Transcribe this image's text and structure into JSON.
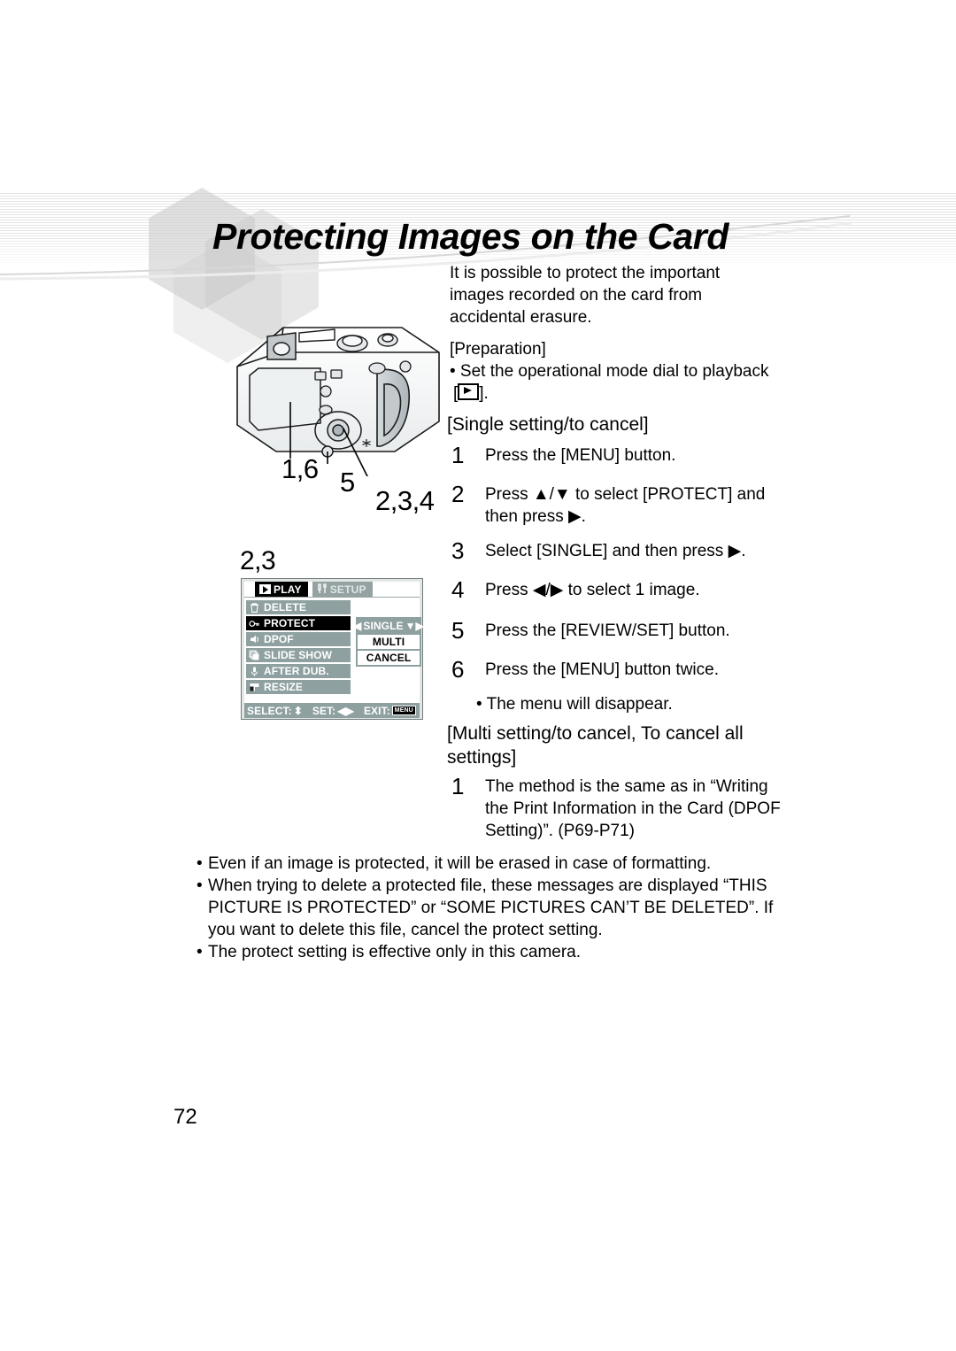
{
  "page": {
    "title": "Protecting Images on the Card",
    "number": "72"
  },
  "intro": {
    "text": "It is possible to protect the important images recorded on the card from accidental erasure."
  },
  "preparation": {
    "heading": "[Preparation]",
    "bullet": "• Set the operational mode dial to playback",
    "bullet_tail": "].",
    "bracket_open": "[",
    "icon": "playback-icon"
  },
  "single_section": {
    "heading": "[Single setting/to cancel]",
    "steps": [
      {
        "num": "1",
        "text": "Press the [MENU] button."
      },
      {
        "num": "2",
        "text": "Press ▲/▼ to select [PROTECT] and then press ▶."
      },
      {
        "num": "3",
        "text": "Select [SINGLE] and then press ▶."
      },
      {
        "num": "4",
        "text": "Press ◀/▶ to select 1 image."
      },
      {
        "num": "5",
        "text": "Press the [REVIEW/SET] button."
      },
      {
        "num": "6",
        "text": "Press the [MENU] button twice."
      }
    ],
    "note": "• The menu will disappear."
  },
  "multi_section": {
    "heading": "[Multi setting/to cancel, To cancel all settings]",
    "steps": [
      {
        "num": "1",
        "text": "The method is the same as in “Writing the Print Information in the Card (DPOF Setting)”. (P69-P71)"
      }
    ]
  },
  "bottom_notes": {
    "bullet": "•",
    "items": [
      "Even if an image is protected, it will be erased in case of formatting.",
      "When trying to delete a protected file, these messages are displayed “THIS PICTURE IS PROTECTED” or “SOME PICTURES CAN’T BE DELETED”. If you want to delete this file, cancel the protect setting.",
      "The protect setting is effective only in this camera."
    ]
  },
  "camera_figure": {
    "callouts": [
      {
        "id": "menu-button",
        "label": "1,6"
      },
      {
        "id": "review-set-button",
        "label": "5"
      },
      {
        "id": "cursor-button",
        "label": "2,3,4"
      }
    ]
  },
  "lcd": {
    "step_label": "2,3",
    "tabs": [
      {
        "label": "PLAY",
        "icon": "play-icon",
        "active": true
      },
      {
        "label": "SETUP",
        "icon": "tools-icon",
        "active": false
      }
    ],
    "menu_items": [
      {
        "label": "DELETE",
        "icon": "trash-icon",
        "selected": false
      },
      {
        "label": "PROTECT",
        "icon": "key-icon",
        "selected": true
      },
      {
        "label": "DPOF",
        "icon": "print-icon",
        "selected": false
      },
      {
        "label": "SLIDE SHOW",
        "icon": "slideshow-icon",
        "selected": false
      },
      {
        "label": "AFTER DUB.",
        "icon": "microphone-icon",
        "selected": false
      },
      {
        "label": "RESIZE",
        "icon": "resize-icon",
        "selected": false
      }
    ],
    "submenu": [
      {
        "label": "SINGLE",
        "left_arrow": "◀",
        "right_arrows": "▼▶",
        "highlighted": true
      },
      {
        "label": "MULTI",
        "highlighted": false
      },
      {
        "label": "CANCEL",
        "highlighted": false
      }
    ],
    "status_bar": {
      "select_label": "SELECT:",
      "select_icon": "⬍",
      "set_label": "SET:",
      "set_icon": "◀▶",
      "exit_label": "EXIT:",
      "exit_key": "MENU"
    }
  }
}
